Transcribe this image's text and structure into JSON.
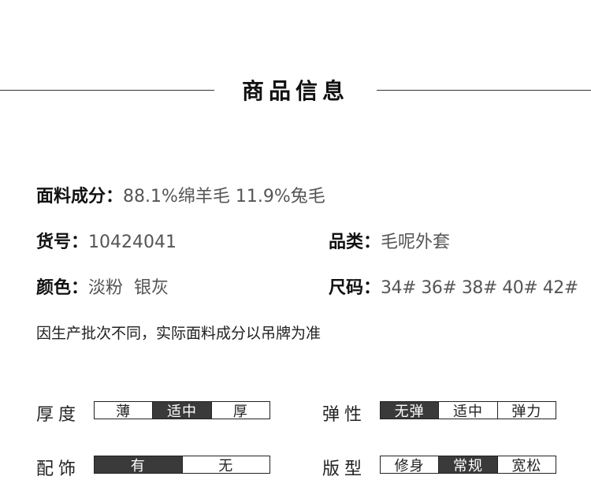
{
  "header": {
    "title": "商品信息"
  },
  "info": {
    "fabric": {
      "label": "面料成分：",
      "value": "88.1%绵羊毛 11.9%兔毛"
    },
    "sku": {
      "label": "货号：",
      "value": "10424041"
    },
    "category": {
      "label": "品类：",
      "value": "毛呢外套"
    },
    "color": {
      "label": "颜色：",
      "value": "淡粉  银灰"
    },
    "size": {
      "label": "尺码：",
      "value": "34# 36# 38# 40# 42#"
    }
  },
  "note": "因生产批次不同，实际面料成分以吊牌为准",
  "ratings": {
    "thickness": {
      "label": "厚度",
      "options": [
        "薄",
        "适中",
        "厚"
      ],
      "selected": 1
    },
    "elasticity": {
      "label": "弹性",
      "options": [
        "无弹",
        "适中",
        "弹力"
      ],
      "selected": 0
    },
    "accessory": {
      "label": "配饰",
      "options": [
        "有",
        "无"
      ],
      "selected": 0
    },
    "fit": {
      "label": "版型",
      "options": [
        "修身",
        "常规",
        "宽松"
      ],
      "selected": 1
    }
  }
}
